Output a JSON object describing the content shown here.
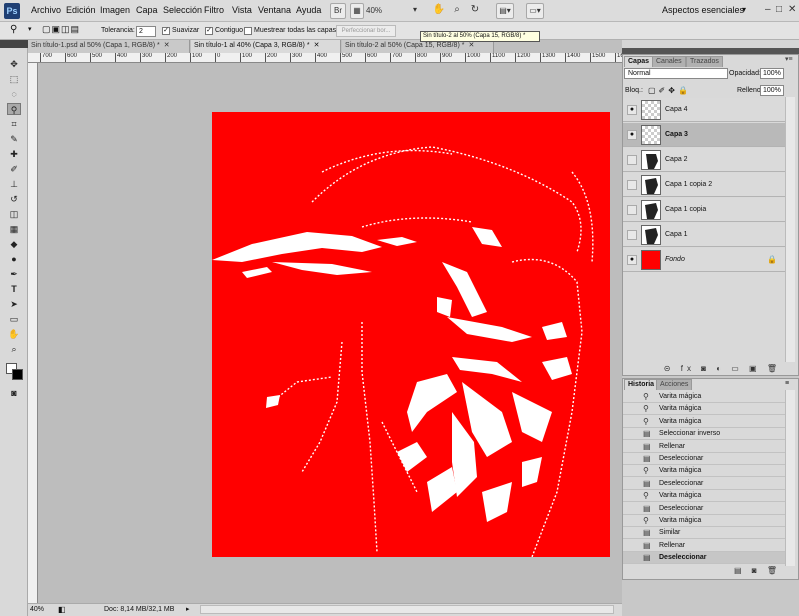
{
  "app": {
    "logo": "Ps"
  },
  "menu": [
    "Archivo",
    "Edición",
    "Imagen",
    "Capa",
    "Selección",
    "Filtro",
    "Vista",
    "Ventana",
    "Ayuda"
  ],
  "menubar": {
    "zoom": "40%",
    "workspace": "Aspectos esenciales"
  },
  "options": {
    "tolerance_label": "Tolerancia:",
    "tolerance_value": "2",
    "smooth_label": "Suavizar",
    "contiguous_label": "Contiguo",
    "sample_all_label": "Muestrear todas las capas",
    "refine_label": "Perfeccionar bor..."
  },
  "tabs": [
    {
      "label": "Sin título-1.psd al 50% (Capa 1, RGB/8) *"
    },
    {
      "label": "Sin título-1 al 40% (Capa 3, RGB/8) *"
    },
    {
      "label": "Sin título-2 al 50% (Capa 15, RGB/8) *"
    }
  ],
  "tooltip": "Sin título-2 al 50% (Capa 15, RGB/8) *",
  "ruler_ticks": [
    "700",
    "600",
    "500",
    "400",
    "300",
    "200",
    "100",
    "0",
    "100",
    "200",
    "300",
    "400",
    "500",
    "600",
    "700",
    "800",
    "900",
    "1000",
    "1100",
    "1200",
    "1300",
    "1400",
    "1500",
    "1600"
  ],
  "status": {
    "zoom": "40%",
    "doc": "Doc: 8,14 MB/32,1 MB"
  },
  "layers_panel": {
    "tabs": [
      "Capas",
      "Canales",
      "Trazados"
    ],
    "blend_mode": "Normal",
    "opacity_label": "Opacidad:",
    "opacity": "100%",
    "lock_label": "Bloq.:",
    "fill_label": "Relleno:",
    "fill": "100%",
    "layers": [
      {
        "name": "Capa 4"
      },
      {
        "name": "Capa 3"
      },
      {
        "name": "Capa 2"
      },
      {
        "name": "Capa 1 copia 2"
      },
      {
        "name": "Capa 1 copia"
      },
      {
        "name": "Capa 1"
      },
      {
        "name": "Fondo"
      }
    ]
  },
  "history_panel": {
    "tabs": [
      "Historia",
      "Acciones"
    ],
    "items": [
      "Varita mágica",
      "Varita mágica",
      "Varita mágica",
      "Seleccionar inverso",
      "Rellenar",
      "Deseleccionar",
      "Varita mágica",
      "Deseleccionar",
      "Varita mágica",
      "Deseleccionar",
      "Varita mágica",
      "Similar",
      "Rellenar",
      "Deseleccionar"
    ]
  },
  "colors": {
    "canvas_fill": "#ff0000",
    "artwork": "#ffffff"
  }
}
